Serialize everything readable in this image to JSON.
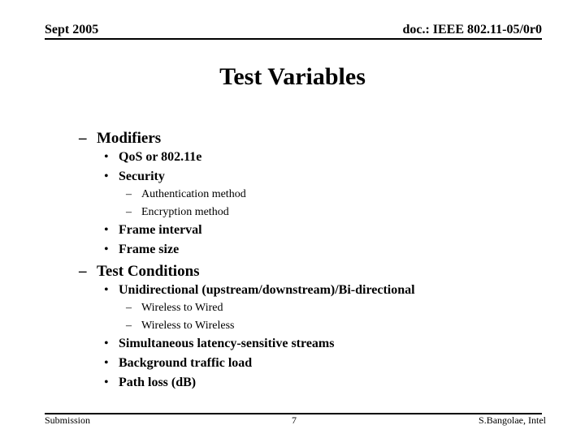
{
  "header": {
    "date": "Sept 2005",
    "doc_id": "doc.: IEEE 802.11-05/0r0"
  },
  "title": "Test Variables",
  "sections": [
    {
      "marker": "–",
      "label": "Modifiers",
      "items": [
        {
          "marker": "•",
          "label": "QoS or 802.11e"
        },
        {
          "marker": "•",
          "label": "Security",
          "subitems": [
            {
              "marker": "–",
              "label": "Authentication method"
            },
            {
              "marker": "–",
              "label": "Encryption method"
            }
          ]
        },
        {
          "marker": "•",
          "label": "Frame interval"
        },
        {
          "marker": "•",
          "label": "Frame size"
        }
      ]
    },
    {
      "marker": "–",
      "label": "Test Conditions",
      "items": [
        {
          "marker": "•",
          "label": "Unidirectional (upstream/downstream)/Bi-directional",
          "subitems": [
            {
              "marker": "–",
              "label": "Wireless to Wired"
            },
            {
              "marker": "–",
              "label": "Wireless to Wireless"
            }
          ]
        },
        {
          "marker": "•",
          "label": "Simultaneous latency-sensitive streams"
        },
        {
          "marker": "•",
          "label": "Background traffic load"
        },
        {
          "marker": "•",
          "label": "Path loss (dB)"
        }
      ]
    }
  ],
  "footer": {
    "left": "Submission",
    "page_number": "7",
    "author": "S.Bangolae, Intel"
  }
}
